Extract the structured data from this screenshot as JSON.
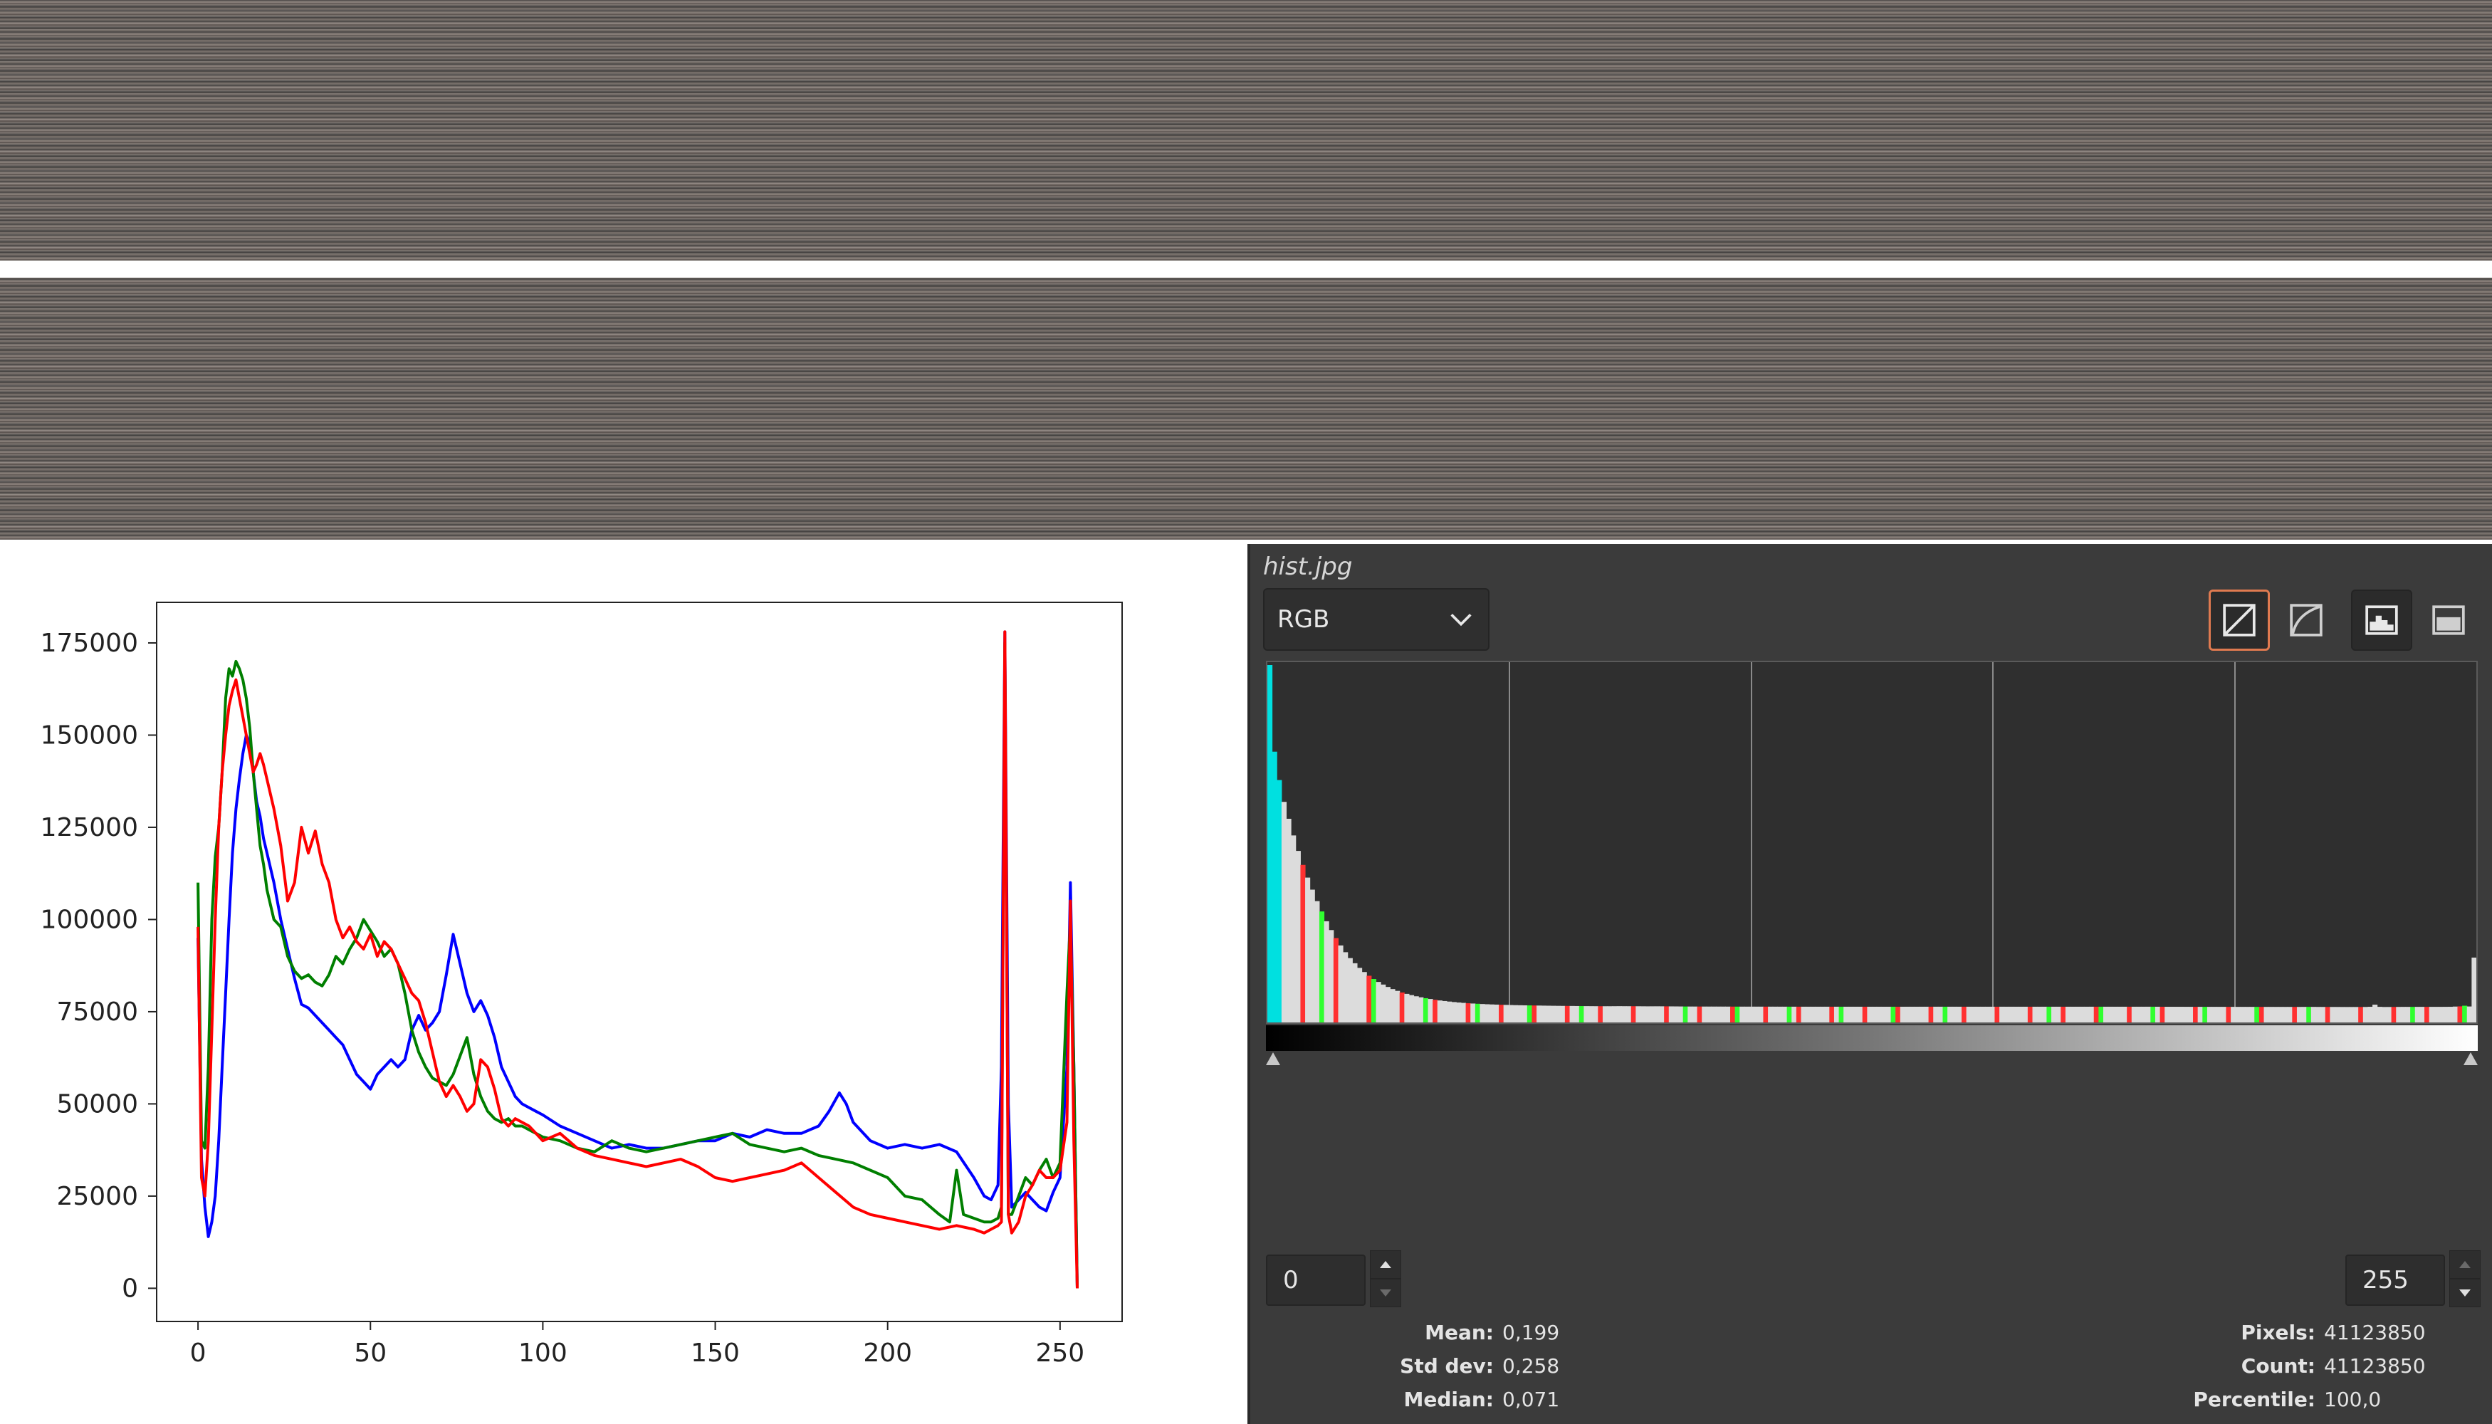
{
  "panel": {
    "title": "hist.jpg",
    "channel": "RGB",
    "low_value": "0",
    "high_value": "255",
    "stats_left": [
      {
        "label": "Mean:",
        "value": "0,199"
      },
      {
        "label": "Std dev:",
        "value": "0,258"
      },
      {
        "label": "Median:",
        "value": "0,071"
      }
    ],
    "stats_right": [
      {
        "label": "Pixels:",
        "value": "41123850"
      },
      {
        "label": "Count:",
        "value": "41123850"
      },
      {
        "label": "Percentile:",
        "value": "100,0"
      }
    ],
    "icons": {
      "linear": "linear-histogram-icon",
      "log": "logarithmic-histogram-icon",
      "hist_a": "histogram-view-icon",
      "hist_b": "histogram-view-alt-icon",
      "dropdown": "chevron-down-icon"
    },
    "accent": "#e07a50"
  },
  "chart_data": {
    "type": "line",
    "xlim": [
      -12,
      268
    ],
    "ylim": [
      -9000,
      186000
    ],
    "xticks": [
      0,
      50,
      100,
      150,
      200,
      250
    ],
    "yticks": [
      0,
      25000,
      50000,
      75000,
      100000,
      125000,
      150000,
      175000
    ],
    "title": "",
    "xlabel": "",
    "ylabel": "",
    "series": [
      {
        "color": "#0000ff",
        "x": [
          0,
          1,
          2,
          3,
          4,
          5,
          6,
          7,
          8,
          9,
          10,
          11,
          12,
          13,
          14,
          15,
          16,
          17,
          18,
          19,
          20,
          22,
          24,
          26,
          28,
          30,
          32,
          34,
          36,
          38,
          40,
          42,
          44,
          46,
          48,
          50,
          52,
          54,
          56,
          58,
          60,
          62,
          64,
          66,
          68,
          70,
          72,
          74,
          76,
          78,
          80,
          82,
          84,
          86,
          88,
          90,
          92,
          94,
          96,
          98,
          100,
          105,
          110,
          115,
          120,
          125,
          130,
          135,
          140,
          145,
          150,
          155,
          160,
          165,
          170,
          175,
          180,
          183,
          186,
          188,
          190,
          195,
          200,
          205,
          210,
          215,
          220,
          225,
          228,
          230,
          232,
          233,
          234,
          235,
          236,
          238,
          240,
          242,
          244,
          246,
          248,
          250,
          252,
          253,
          254,
          255
        ],
        "y": [
          95000,
          35000,
          22000,
          14000,
          18000,
          25000,
          40000,
          60000,
          80000,
          100000,
          118000,
          130000,
          138000,
          145000,
          150000,
          148000,
          140000,
          132000,
          128000,
          122000,
          118000,
          110000,
          100000,
          92000,
          84000,
          77000,
          76000,
          74000,
          72000,
          70000,
          68000,
          66000,
          62000,
          58000,
          56000,
          54000,
          58000,
          60000,
          62000,
          60000,
          62000,
          70000,
          74000,
          70000,
          72000,
          75000,
          85000,
          96000,
          88000,
          80000,
          75000,
          78000,
          74000,
          68000,
          60000,
          56000,
          52000,
          50000,
          49000,
          48000,
          47000,
          44000,
          42000,
          40000,
          38000,
          39000,
          38000,
          38000,
          39000,
          40000,
          40000,
          42000,
          41000,
          43000,
          42000,
          42000,
          44000,
          48000,
          53000,
          50000,
          45000,
          40000,
          38000,
          39000,
          38000,
          39000,
          37000,
          30000,
          25000,
          24000,
          28000,
          60000,
          178000,
          50000,
          22000,
          24000,
          26000,
          24000,
          22000,
          21000,
          26000,
          30000,
          60000,
          110000,
          60000,
          0
        ]
      },
      {
        "color": "#007f00",
        "x": [
          0,
          1,
          2,
          3,
          4,
          5,
          6,
          7,
          8,
          9,
          10,
          11,
          12,
          13,
          14,
          15,
          16,
          17,
          18,
          19,
          20,
          22,
          24,
          26,
          28,
          30,
          32,
          34,
          36,
          38,
          40,
          42,
          44,
          46,
          48,
          50,
          52,
          54,
          56,
          58,
          60,
          62,
          64,
          66,
          68,
          70,
          72,
          74,
          76,
          78,
          80,
          82,
          84,
          86,
          88,
          90,
          92,
          94,
          96,
          98,
          100,
          105,
          110,
          115,
          120,
          125,
          130,
          135,
          140,
          145,
          150,
          155,
          160,
          165,
          170,
          175,
          180,
          185,
          190,
          195,
          200,
          205,
          210,
          215,
          218,
          220,
          222,
          225,
          228,
          230,
          232,
          233,
          234,
          235,
          236,
          238,
          240,
          242,
          244,
          246,
          248,
          250,
          252,
          253,
          254,
          255
        ],
        "y": [
          110000,
          40000,
          38000,
          60000,
          100000,
          117000,
          125000,
          140000,
          160000,
          168000,
          166000,
          170000,
          168000,
          165000,
          160000,
          152000,
          140000,
          130000,
          120000,
          115000,
          108000,
          100000,
          98000,
          90000,
          86000,
          84000,
          85000,
          83000,
          82000,
          85000,
          90000,
          88000,
          92000,
          95000,
          100000,
          97000,
          94000,
          90000,
          92000,
          88000,
          80000,
          70000,
          64000,
          60000,
          57000,
          56000,
          55000,
          58000,
          63000,
          68000,
          58000,
          52000,
          48000,
          46000,
          45000,
          46000,
          44000,
          44000,
          43000,
          42000,
          41000,
          40000,
          38000,
          37000,
          40000,
          38000,
          37000,
          38000,
          39000,
          40000,
          41000,
          42000,
          39000,
          38000,
          37000,
          38000,
          36000,
          35000,
          34000,
          32000,
          30000,
          25000,
          24000,
          20000,
          18000,
          32000,
          20000,
          19000,
          18000,
          18000,
          19000,
          22000,
          175000,
          20000,
          20000,
          25000,
          30000,
          28000,
          32000,
          35000,
          30000,
          34000,
          80000,
          100000,
          60000,
          0
        ]
      },
      {
        "color": "#ff0000",
        "x": [
          0,
          1,
          2,
          3,
          4,
          5,
          6,
          7,
          8,
          9,
          10,
          11,
          12,
          13,
          14,
          15,
          16,
          17,
          18,
          19,
          20,
          22,
          24,
          26,
          28,
          30,
          32,
          34,
          36,
          38,
          40,
          42,
          44,
          46,
          48,
          50,
          52,
          54,
          56,
          58,
          60,
          62,
          64,
          66,
          68,
          70,
          72,
          74,
          76,
          78,
          80,
          82,
          84,
          86,
          88,
          90,
          92,
          94,
          96,
          98,
          100,
          105,
          110,
          115,
          120,
          125,
          130,
          135,
          140,
          145,
          150,
          155,
          160,
          165,
          170,
          175,
          180,
          185,
          190,
          195,
          200,
          205,
          210,
          215,
          220,
          225,
          228,
          230,
          232,
          233,
          234,
          235,
          236,
          238,
          240,
          242,
          244,
          246,
          248,
          250,
          252,
          253,
          254,
          255
        ],
        "y": [
          98000,
          30000,
          25000,
          40000,
          70000,
          100000,
          125000,
          140000,
          150000,
          158000,
          162000,
          165000,
          160000,
          155000,
          150000,
          145000,
          140000,
          142000,
          145000,
          142000,
          138000,
          130000,
          120000,
          105000,
          110000,
          125000,
          118000,
          124000,
          115000,
          110000,
          100000,
          95000,
          98000,
          94000,
          92000,
          96000,
          90000,
          94000,
          92000,
          88000,
          84000,
          80000,
          78000,
          72000,
          64000,
          56000,
          52000,
          55000,
          52000,
          48000,
          50000,
          62000,
          60000,
          54000,
          46000,
          44000,
          46000,
          45000,
          44000,
          42000,
          40000,
          42000,
          38000,
          36000,
          35000,
          34000,
          33000,
          34000,
          35000,
          33000,
          30000,
          29000,
          30000,
          31000,
          32000,
          34000,
          30000,
          26000,
          22000,
          20000,
          19000,
          18000,
          17000,
          16000,
          17000,
          16000,
          15000,
          16000,
          17000,
          18000,
          178000,
          20000,
          15000,
          18000,
          25000,
          28000,
          32000,
          30000,
          30000,
          32000,
          45000,
          105000,
          40000,
          0
        ]
      }
    ]
  }
}
